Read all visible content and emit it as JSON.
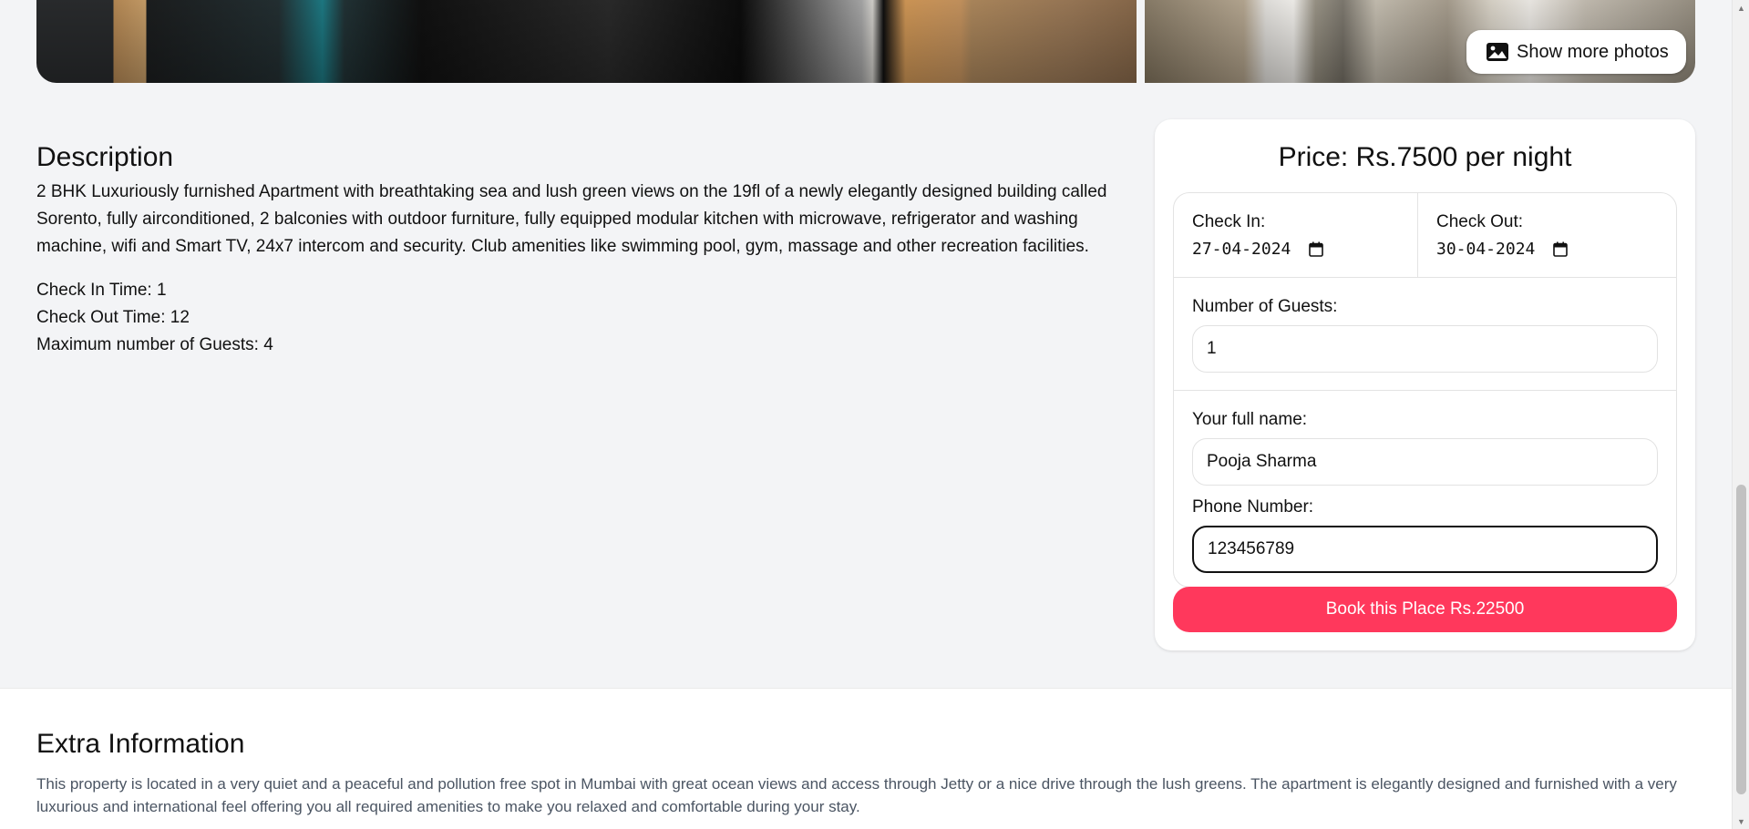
{
  "gallery": {
    "show_more_label": "Show more photos",
    "show_more_icon": "image-icon"
  },
  "description": {
    "title": "Description",
    "text": "2 BHK Luxuriously furnished Apartment with breathtaking sea and lush green views on the 19fl of a newly elegantly designed building called Sorento, fully airconditioned, 2 balconies with outdoor furniture, fully equipped modular kitchen with microwave, refrigerator and washing machine, wifi and Smart TV, 24x7 intercom and security. Club amenities like swimming pool, gym, massage and other recreation facilities.",
    "check_in_time": "Check In Time: 1",
    "check_out_time": "Check Out Time: 12",
    "max_guests": "Maximum number of Guests: 4"
  },
  "booking": {
    "price": "Price: Rs.7500 per night",
    "check_in_label": "Check In:",
    "check_in_value": "27-04-2024",
    "check_out_label": "Check Out:",
    "check_out_value": "30-04-2024",
    "guests_label": "Number of Guests:",
    "guests_value": "1",
    "name_label": "Your full name:",
    "name_value": "Pooja Sharma",
    "phone_label": "Phone Number:",
    "phone_value": "123456789",
    "book_button": "Book this Place Rs.22500",
    "accent_color": "#ff385c"
  },
  "extra": {
    "title": "Extra Information",
    "text": "This property is located in a very quiet and a peaceful and pollution free spot in Mumbai with great ocean views and access through Jetty or a nice drive through the lush greens. The apartment is elegantly designed and furnished with a very luxurious and international feel offering you all required amenities to make you relaxed and comfortable during your stay."
  },
  "icons": {
    "calendar": "calendar-icon",
    "scroll_up": "scroll-up-arrow",
    "scroll_down": "scroll-down-arrow"
  }
}
